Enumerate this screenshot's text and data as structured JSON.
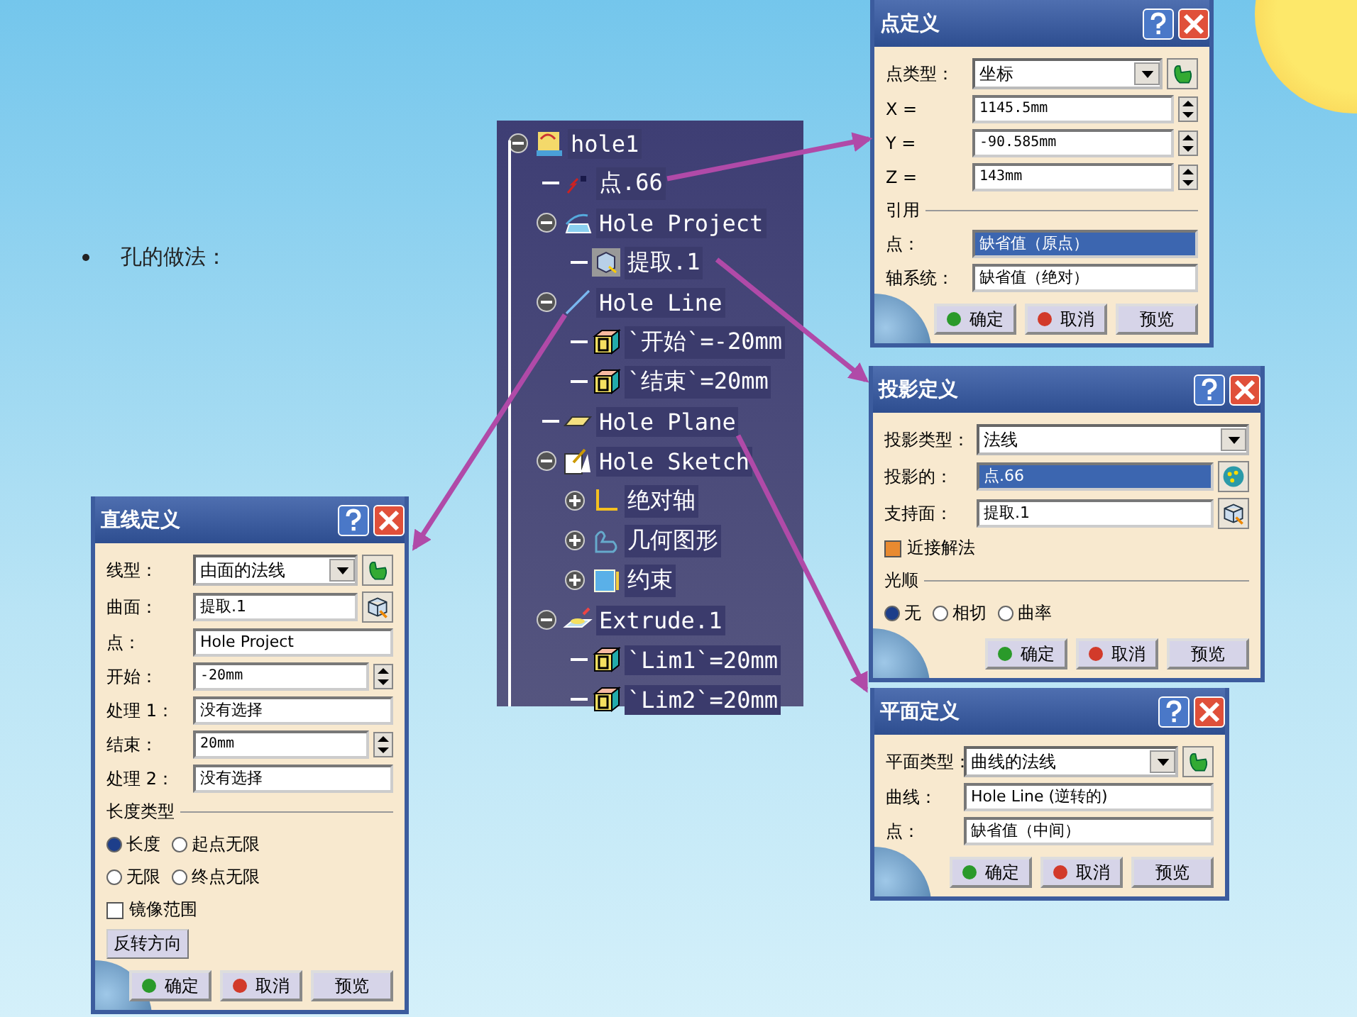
{
  "bullet": {
    "text": "孔的做法："
  },
  "tree": {
    "items": [
      {
        "label": "hole1",
        "kind": "part",
        "expanded": true,
        "children": [
          {
            "label": "点.66",
            "kind": "point"
          },
          {
            "label": "Hole Project",
            "kind": "projection",
            "expanded": true,
            "children": [
              {
                "label": "提取.1",
                "kind": "extract"
              }
            ]
          },
          {
            "label": "Hole Line",
            "kind": "line",
            "expanded": true,
            "children": [
              {
                "label": "`开始`=-20mm",
                "kind": "parameter"
              },
              {
                "label": "`结束`=20mm",
                "kind": "parameter"
              }
            ]
          },
          {
            "label": "Hole Plane",
            "kind": "plane"
          },
          {
            "label": "Hole Sketch",
            "kind": "sketch",
            "expanded": true,
            "children": [
              {
                "label": "绝对轴",
                "kind": "axis",
                "expanded": false
              },
              {
                "label": "几何图形",
                "kind": "geometry",
                "expanded": false
              },
              {
                "label": "约束",
                "kind": "constraint",
                "expanded": false
              }
            ]
          },
          {
            "label": "Extrude.1",
            "kind": "extrude",
            "expanded": true,
            "children": [
              {
                "label": "`Lim1`=20mm",
                "kind": "parameter"
              },
              {
                "label": "`Lim2`=20mm",
                "kind": "parameter"
              }
            ]
          }
        ]
      }
    ]
  },
  "dialogs": [
    {
      "title": "点定义",
      "rows": [
        {
          "kind": "combo",
          "label": "点类型：",
          "value": "坐标",
          "side": {
            "kind": "hand"
          }
        },
        {
          "kind": "spin",
          "label": "X =",
          "value": "1145.5mm"
        },
        {
          "kind": "spin",
          "label": "Y =",
          "value": "-90.585mm"
        },
        {
          "kind": "spin",
          "label": "Z =",
          "value": "143mm"
        },
        {
          "kind": "section",
          "label": "引用"
        },
        {
          "kind": "field",
          "label": "点：",
          "value": "缺省值（原点）",
          "selected": true
        },
        {
          "kind": "field",
          "label": "轴系统：",
          "value": "缺省值（绝对）",
          "selected": false
        }
      ],
      "buttons": [
        {
          "label": "确定",
          "kind": "ok"
        },
        {
          "label": "取消",
          "kind": "cancel"
        },
        {
          "label": "预览",
          "kind": "preview"
        }
      ]
    },
    {
      "title": "投影定义",
      "rows": [
        {
          "kind": "combo",
          "label": "投影类型：",
          "value": "法线"
        },
        {
          "kind": "field",
          "label": "投影的：",
          "value": "点.66",
          "selected": true,
          "side": {
            "kind": "points"
          }
        },
        {
          "kind": "field",
          "label": "支持面：",
          "value": "提取.1",
          "selected": false,
          "side": {
            "kind": "cube"
          }
        },
        {
          "kind": "checkbox",
          "label": "近接解法",
          "checked": true
        },
        {
          "kind": "section",
          "label": "光顺"
        },
        {
          "kind": "radios",
          "options": [
            {
              "label": "无",
              "selected": true
            },
            {
              "label": "相切",
              "selected": false
            },
            {
              "label": "曲率",
              "selected": false
            }
          ]
        }
      ],
      "buttons": [
        {
          "label": "确定",
          "kind": "ok"
        },
        {
          "label": "取消",
          "kind": "cancel"
        },
        {
          "label": "预览",
          "kind": "preview"
        }
      ]
    },
    {
      "title": "平面定义",
      "rows": [
        {
          "kind": "combo",
          "label": "平面类型：",
          "value": "曲线的法线",
          "side": {
            "kind": "hand"
          }
        },
        {
          "kind": "field",
          "label": "曲线：",
          "value": "Hole Line (逆转的)",
          "selected": false
        },
        {
          "kind": "field",
          "label": "点：",
          "value": "缺省值（中间）",
          "selected": false
        }
      ],
      "buttons": [
        {
          "label": "确定",
          "kind": "ok"
        },
        {
          "label": "取消",
          "kind": "cancel"
        },
        {
          "label": "预览",
          "kind": "preview"
        }
      ]
    },
    {
      "title": "直线定义",
      "rows": [
        {
          "kind": "combo",
          "label": "线型：",
          "value": "由面的法线",
          "side": {
            "kind": "hand"
          }
        },
        {
          "kind": "field",
          "label": "曲面：",
          "value": "提取.1",
          "selected": false,
          "side": {
            "kind": "cube"
          }
        },
        {
          "kind": "field",
          "label": "点：",
          "value": "Hole Project",
          "selected": false
        },
        {
          "kind": "spin",
          "label": "开始：",
          "value": "-20mm"
        },
        {
          "kind": "field",
          "label": "处理 1：",
          "value": "没有选择",
          "selected": false
        },
        {
          "kind": "spin",
          "label": "结束：",
          "value": "20mm"
        },
        {
          "kind": "field",
          "label": "处理 2：",
          "value": "没有选择",
          "selected": false
        },
        {
          "kind": "section",
          "label": "长度类型"
        },
        {
          "kind": "radios",
          "options": [
            {
              "label": "长度",
              "selected": true
            },
            {
              "label": "起点无限",
              "selected": false
            }
          ]
        },
        {
          "kind": "radios",
          "options": [
            {
              "label": "无限",
              "selected": false
            },
            {
              "label": "终点无限",
              "selected": false
            }
          ]
        },
        {
          "kind": "checkbox",
          "label": "镜像范围",
          "checked": false
        },
        {
          "kind": "button",
          "label": "反转方向"
        }
      ],
      "buttons": [
        {
          "label": "确定",
          "kind": "ok"
        },
        {
          "label": "取消",
          "kind": "cancel"
        },
        {
          "label": "预览",
          "kind": "preview"
        }
      ]
    }
  ]
}
